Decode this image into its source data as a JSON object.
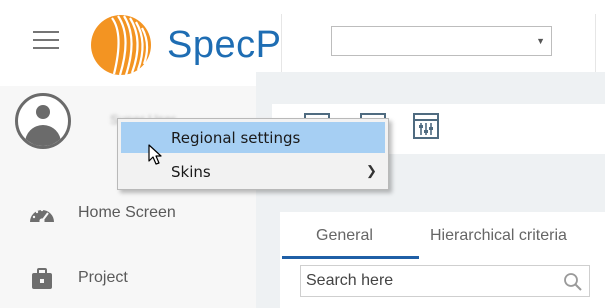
{
  "header": {
    "brand_text": "SpecP",
    "select": {
      "value": ""
    },
    "accent_color": "#1e6db3",
    "logo_color": "#f39422"
  },
  "sidebar": {
    "username": "Super User",
    "items": [
      {
        "label": "Home Screen",
        "icon": "dashboard-gauge-icon"
      },
      {
        "label": "Project",
        "icon": "briefcase-icon"
      }
    ]
  },
  "context_menu": {
    "items": [
      {
        "label": "Regional settings",
        "highlighted": true
      },
      {
        "label": "Skins",
        "has_submenu": true
      }
    ]
  },
  "main": {
    "toolbar_icons": [
      "table-icon",
      "table-icon",
      "settings-sliders-icon"
    ],
    "tabs": [
      {
        "label": "General",
        "active": true
      },
      {
        "label": "Hierarchical criteria",
        "active": false
      }
    ],
    "search": {
      "placeholder": "Search here",
      "value": ""
    }
  }
}
